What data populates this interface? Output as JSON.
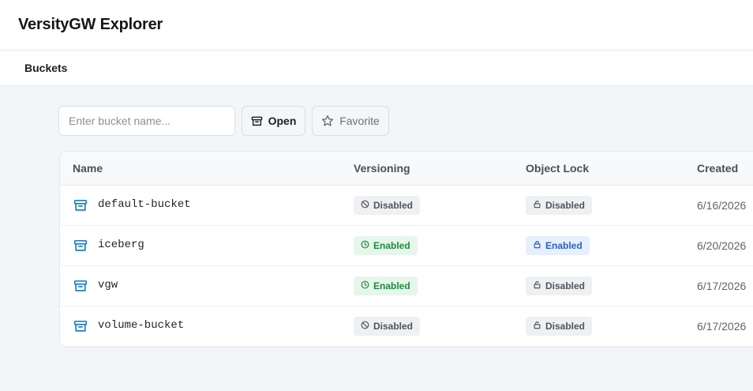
{
  "app": {
    "title": "VersityGW Explorer"
  },
  "nav": {
    "items": [
      {
        "label": "Buckets"
      }
    ]
  },
  "toolbar": {
    "search_placeholder": "Enter bucket name...",
    "search_value": "",
    "open_label": "Open",
    "open_icon": "archive-icon",
    "favorite_label": "Favorite",
    "favorite_icon": "star-icon"
  },
  "table": {
    "columns": [
      "Name",
      "Versioning",
      "Object Lock",
      "Created"
    ],
    "rows": [
      {
        "name": "default-bucket",
        "versioning": "Disabled",
        "versioning_state": "disabled",
        "object_lock": "Disabled",
        "object_lock_state": "disabled",
        "created": "6/16/2026"
      },
      {
        "name": "iceberg",
        "versioning": "Enabled",
        "versioning_state": "enabled",
        "object_lock": "Enabled",
        "object_lock_state": "enabled",
        "created": "6/20/2026"
      },
      {
        "name": "vgw",
        "versioning": "Enabled",
        "versioning_state": "enabled",
        "object_lock": "Disabled",
        "object_lock_state": "disabled",
        "created": "6/17/2026"
      },
      {
        "name": "volume-bucket",
        "versioning": "Disabled",
        "versioning_state": "disabled",
        "object_lock": "Disabled",
        "object_lock_state": "disabled",
        "created": "6/17/2026"
      }
    ]
  },
  "colors": {
    "accent_blue": "#1e7fc2",
    "enabled_green": "#1d8a3e",
    "enabled_blue": "#2a5fc7",
    "background": "#f2f6f9"
  }
}
